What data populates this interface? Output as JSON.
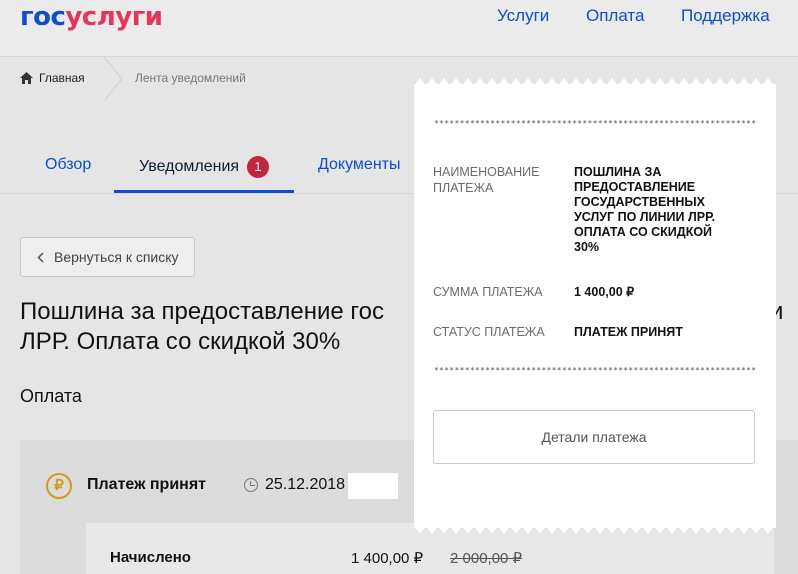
{
  "header": {
    "logo_part1": "гос",
    "logo_part2": "услуги",
    "nav": [
      "Услуги",
      "Оплата",
      "Поддержка"
    ]
  },
  "breadcrumb": {
    "home": "Главная",
    "current": "Лента уведомлений"
  },
  "tabs": [
    {
      "label": "Обзор"
    },
    {
      "label": "Уведомления",
      "badge": "1"
    },
    {
      "label": "Документы"
    }
  ],
  "back_button": "Вернуться к списку",
  "page_title": {
    "line1": "Пошлина за предоставление гос",
    "tail": "и",
    "line2": "ЛРР. Оплата со скидкой 30%"
  },
  "section_label": "Оплата",
  "payment_card": {
    "status": "Платеж принят",
    "date": "25.12.2018",
    "charged_label": "Начислено",
    "amount": "1 400,00 ₽",
    "old_amount": "2 000,00 ₽"
  },
  "receipt": {
    "stars": "**************************************************************************",
    "name_label": "НАИМЕНОВАНИЕ ПЛАТЕЖА",
    "name_value": "ПОШЛИНА ЗА ПРЕДОСТАВЛЕНИЕ ГОСУДАРСТВЕННЫХ УСЛУГ ПО ЛИНИИ ЛРР. ОПЛАТА СО СКИДКОЙ 30%",
    "sum_label": "СУММА ПЛАТЕЖА",
    "sum_value": "1 400,00 ₽",
    "status_label": "СТАТУС ПЛАТЕЖА",
    "status_value": "ПЛАТЕЖ ПРИНЯТ",
    "details_button": "Детали платежа"
  },
  "colors": {
    "brand_blue": "#0d4cd3",
    "brand_red": "#e8345a",
    "badge_red": "#c3263a",
    "ruble_gold": "#d39c1b"
  }
}
